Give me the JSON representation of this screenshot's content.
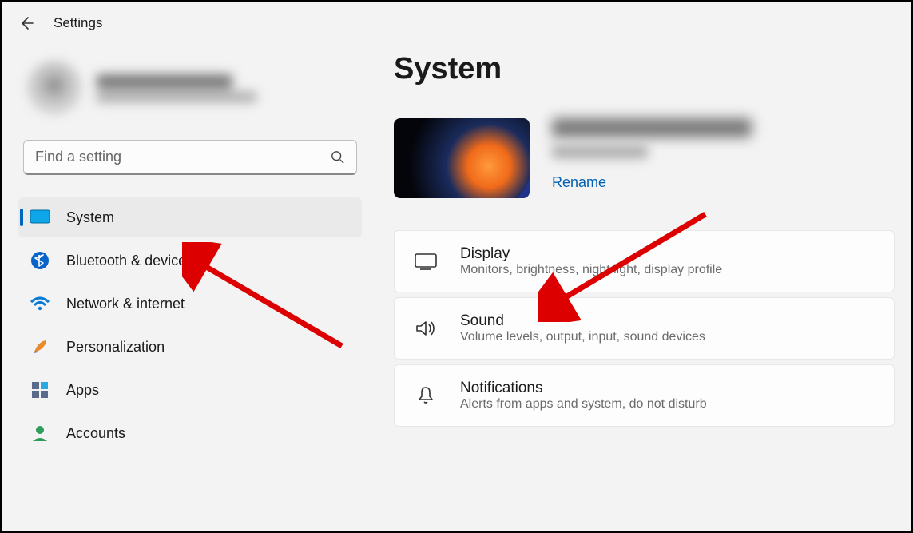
{
  "header": {
    "title": "Settings"
  },
  "search": {
    "placeholder": "Find a setting"
  },
  "sidebar": {
    "items": [
      {
        "label": "System",
        "icon": "system-icon",
        "active": true
      },
      {
        "label": "Bluetooth & devices",
        "icon": "bluetooth-icon",
        "active": false
      },
      {
        "label": "Network & internet",
        "icon": "wifi-icon",
        "active": false
      },
      {
        "label": "Personalization",
        "icon": "brush-icon",
        "active": false
      },
      {
        "label": "Apps",
        "icon": "apps-icon",
        "active": false
      },
      {
        "label": "Accounts",
        "icon": "person-icon",
        "active": false
      }
    ]
  },
  "main": {
    "title": "System",
    "rename_label": "Rename",
    "cards": [
      {
        "title": "Display",
        "subtitle": "Monitors, brightness, night light, display profile",
        "icon": "monitor-icon"
      },
      {
        "title": "Sound",
        "subtitle": "Volume levels, output, input, sound devices",
        "icon": "sound-icon"
      },
      {
        "title": "Notifications",
        "subtitle": "Alerts from apps and system, do not disturb",
        "icon": "bell-icon"
      }
    ]
  }
}
